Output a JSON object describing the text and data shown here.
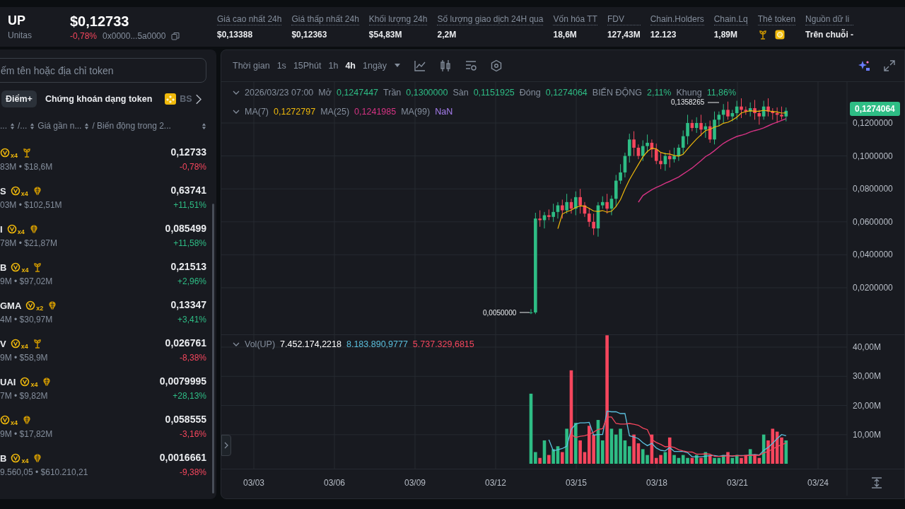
{
  "token": {
    "symbol": "UP",
    "name": "Unitas",
    "price": "$0,12733",
    "change": "-0,78%",
    "negative": true,
    "address": "0x0000...5a0000"
  },
  "stats": [
    {
      "label": "Giá cao nhất 24h",
      "value": "$0,13388",
      "kind": "text"
    },
    {
      "label": "Giá thấp nhất 24h",
      "value": "$0,12363",
      "kind": "text"
    },
    {
      "label": "Khối lượng 24h",
      "value": "$54,83M",
      "kind": "text"
    },
    {
      "label": "Số lượng giao dịch 24H qua",
      "value": "2,2M",
      "kind": "text"
    },
    {
      "label": "Vốn hóa TT",
      "value": "18,6M",
      "kind": "text"
    },
    {
      "label": "FDV",
      "value": "127,43M",
      "kind": "text"
    },
    {
      "label": "Chain.Holders",
      "value": "12.123",
      "kind": "text"
    },
    {
      "label": "Chain.Lq",
      "value": "1,89M",
      "kind": "text"
    },
    {
      "label": "Thẻ token",
      "kind": "icons"
    },
    {
      "label": "Nguồn dữ li",
      "value": "Trên chuỗi -",
      "kind": "text"
    }
  ],
  "sidebar": {
    "search": {
      "placeholder": "ếm tên hoặc địa chỉ token"
    },
    "tabs": [
      {
        "label": "Điểm+",
        "selected": true
      },
      {
        "label": "Chứng khoán dạng token",
        "selected": false
      },
      {
        "label": "BS",
        "selected": false,
        "kind": "chain"
      }
    ],
    "columns": [
      "...",
      "/...",
      "Giá gần n...",
      "/ Biến động trong 2..."
    ],
    "rows": [
      {
        "name": "",
        "badge": "x4",
        "kind": "sprout",
        "sub": "83M • $18,6M",
        "price": "0,12733",
        "change": "-0,78%",
        "negative": true
      },
      {
        "name": "S",
        "badge": "x4",
        "kind": "brain",
        "sub": "03M • $102,51M",
        "price": "0,63741",
        "change": "+11,51%",
        "negative": false
      },
      {
        "name": "I",
        "badge": "x4",
        "kind": "brain",
        "sub": "78M • $21,87M",
        "price": "0,085499",
        "change": "+11,58%",
        "negative": false
      },
      {
        "name": "B",
        "badge": "x4",
        "kind": "sprout",
        "sub": "9M • $97,02M",
        "price": "0,21513",
        "change": "+2,96%",
        "negative": false
      },
      {
        "name": "GMA",
        "badge": "x2",
        "kind": "brain",
        "sub": "4M • $30,97M",
        "price": "0,13347",
        "change": "+3,41%",
        "negative": false
      },
      {
        "name": "V",
        "badge": "x4",
        "kind": "sprout",
        "sub": "9M • $58,9M",
        "price": "0,026761",
        "change": "-8,38%",
        "negative": true
      },
      {
        "name": "UAI",
        "badge": "x4",
        "kind": "brain",
        "sub": "7M • $9,82M",
        "price": "0,0079995",
        "change": "+28,13%",
        "negative": false
      },
      {
        "name": "",
        "badge": "x4",
        "kind": "brain",
        "sub": "9M • $17,82M",
        "price": "0,058555",
        "change": "-3,16%",
        "negative": true
      },
      {
        "name": "B",
        "badge": "x4",
        "kind": "brain",
        "sub": "9.560,05 • $610.210,21",
        "price": "0,0016661",
        "change": "-9,38%",
        "negative": true
      }
    ]
  },
  "chart": {
    "label": "Thời gian",
    "intervals": [
      {
        "label": "1s",
        "selected": false
      },
      {
        "label": "15Phút",
        "selected": false
      },
      {
        "label": "1h",
        "selected": false
      },
      {
        "label": "4h",
        "selected": true
      },
      {
        "label": "1ngày",
        "selected": false
      }
    ],
    "ohlc": [
      {
        "label": "2026/03/23 07:00"
      },
      {
        "label": "Mở",
        "value": "0,1247447"
      },
      {
        "label": "Trần",
        "value": "0,1300000"
      },
      {
        "label": "Sàn",
        "value": "0,1151925"
      },
      {
        "label": "Đóng",
        "value": "0,1274064"
      },
      {
        "label": "BIẾN ĐỘNG",
        "value": "2,11%"
      },
      {
        "label": "Khung",
        "value": "11,86%"
      }
    ],
    "ma": [
      {
        "label": "MA(7)",
        "value": "0,1272797",
        "color": "#f0b90b"
      },
      {
        "label": "MA(25)",
        "value": "0,1241985",
        "color": "#d63384"
      },
      {
        "label": "MA(99)",
        "value": "NaN",
        "color": "#a77ef0"
      }
    ],
    "price_axis": [
      "0,1200000",
      "0,1000000",
      "0,0800000",
      "0,0600000",
      "0,0400000",
      "0,0200000"
    ],
    "last_price": "0,1274064",
    "high_label": "0,1358265",
    "low_label": "0,0050000",
    "volume": {
      "label": "Vol(UP)",
      "values": [
        {
          "value": "7.452.174,2218",
          "color": "#ffffff"
        },
        {
          "value": "8.183.890,9777",
          "color": "#5bc0de"
        },
        {
          "value": "5.737.329,6815",
          "color": "#f6465d"
        }
      ]
    },
    "volume_axis": [
      "40,00M",
      "30,00M",
      "20,00M",
      "10,00M"
    ],
    "dates": [
      "03/03",
      "03/06",
      "03/09",
      "03/12",
      "03/15",
      "03/18",
      "03/21",
      "03/24"
    ]
  }
}
